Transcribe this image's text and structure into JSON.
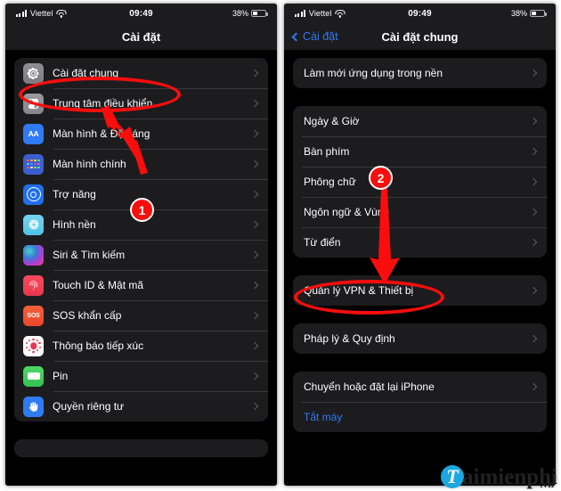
{
  "statusbar": {
    "carrier": "Viettel",
    "time": "09:49",
    "battery_pct": "38%",
    "signal_icon": "cellular-bars-icon",
    "wifi_icon": "wifi-icon",
    "battery_icon": "battery-icon"
  },
  "left_panel": {
    "nav": {
      "title": "Cài đặt"
    },
    "groups": [
      {
        "items": [
          {
            "label": "Cài đặt chung",
            "icon": "gear-icon",
            "highlighted": true
          },
          {
            "label": "Trung tâm điều khiển",
            "icon": "control-center-icon",
            "highlighted": false
          },
          {
            "label": "Màn hình & Độ sáng",
            "icon": "display-brightness-icon",
            "highlighted": false
          },
          {
            "label": "Màn hình chính",
            "icon": "home-screen-icon",
            "highlighted": false
          },
          {
            "label": "Trợ năng",
            "icon": "accessibility-icon",
            "highlighted": false
          },
          {
            "label": "Hình nền",
            "icon": "wallpaper-icon",
            "highlighted": false
          },
          {
            "label": "Siri & Tìm kiếm",
            "icon": "siri-icon",
            "highlighted": false
          },
          {
            "label": "Touch ID & Mật mã",
            "icon": "touch-id-icon",
            "highlighted": false
          },
          {
            "label": "SOS khẩn cấp",
            "icon": "sos-icon",
            "highlighted": false
          },
          {
            "label": "Thông báo tiếp xúc",
            "icon": "exposure-notification-icon",
            "highlighted": false
          },
          {
            "label": "Pin",
            "icon": "battery-settings-icon",
            "highlighted": false
          },
          {
            "label": "Quyền riêng tư",
            "icon": "privacy-hand-icon",
            "highlighted": false
          }
        ]
      }
    ],
    "annotations": {
      "step_number": "1",
      "highlight_color": "#fb0d0d"
    }
  },
  "right_panel": {
    "nav": {
      "back_label": "Cài đặt",
      "title": "Cài đặt chung"
    },
    "groups": [
      {
        "items": [
          {
            "label": "Làm mới ứng dụng trong nền",
            "highlighted": false
          }
        ]
      },
      {
        "items": [
          {
            "label": "Ngày & Giờ",
            "highlighted": false
          },
          {
            "label": "Bàn phím",
            "highlighted": false
          },
          {
            "label": "Phông chữ",
            "highlighted": false
          },
          {
            "label": "Ngôn ngữ & Vùng",
            "highlighted": false
          },
          {
            "label": "Từ điển",
            "highlighted": false
          }
        ]
      },
      {
        "items": [
          {
            "label": "Quản lý VPN & Thiết bị",
            "highlighted": true
          }
        ]
      },
      {
        "items": [
          {
            "label": "Pháp lý & Quy định",
            "highlighted": false
          }
        ]
      },
      {
        "items": [
          {
            "label": "Chuyển hoặc đặt lại iPhone",
            "highlighted": false,
            "style": "normal"
          },
          {
            "label": "Tắt máy",
            "highlighted": false,
            "style": "blue"
          }
        ]
      }
    ],
    "annotations": {
      "step_number": "2",
      "highlight_color": "#fb0d0d"
    }
  },
  "watermark": {
    "logo_letter": "T",
    "text": "aimienphi",
    "tld": ".vn"
  }
}
